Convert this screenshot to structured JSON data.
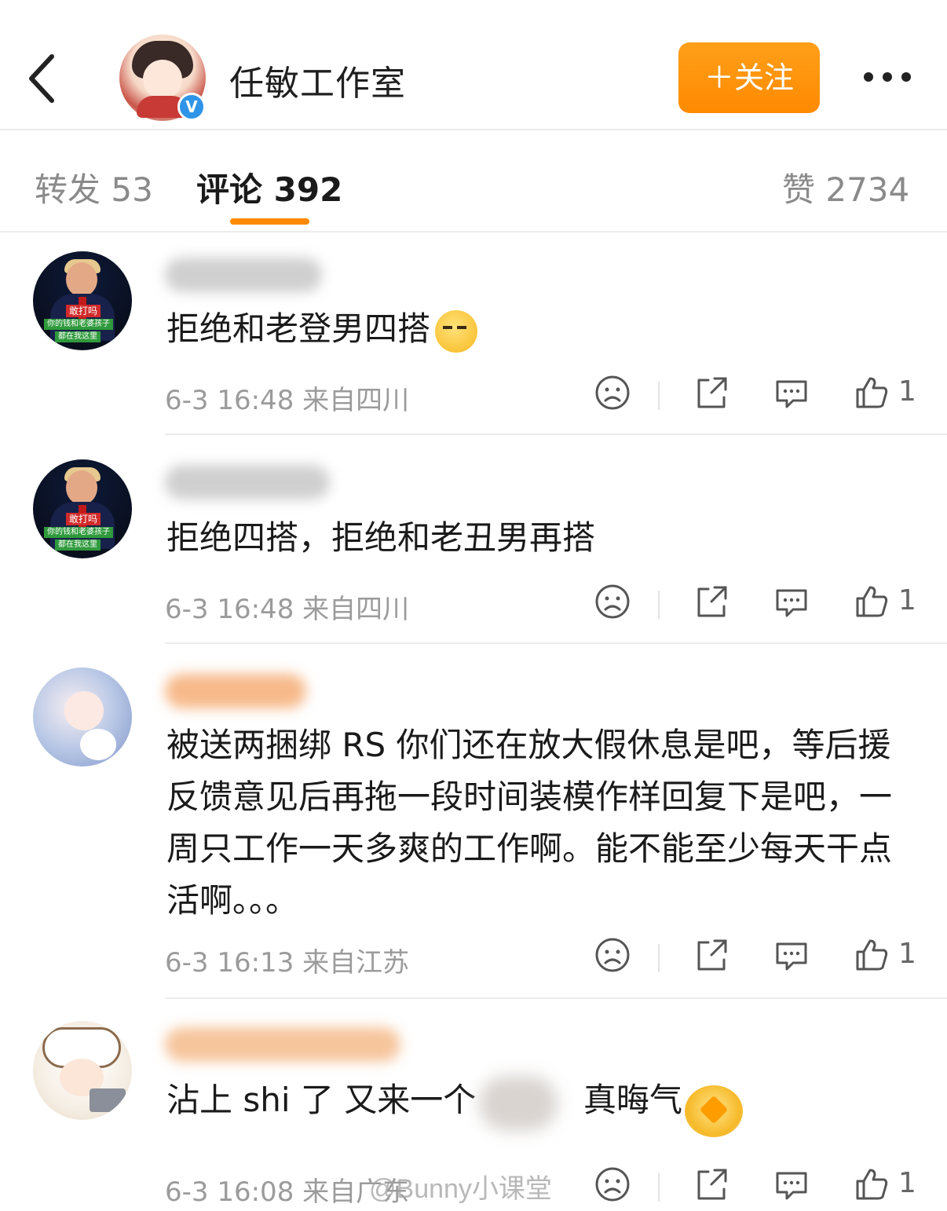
{
  "header": {
    "back_icon": "chevron-left-icon",
    "account_name": "任敏工作室",
    "verified_mark": "V",
    "follow_label": "＋关注",
    "more_icon": "more-dots-icon"
  },
  "tabs": {
    "repost": "转发 53",
    "comments": "评论 392",
    "likes": "赞 2734",
    "accent_color": "#ff8a00"
  },
  "comments": [
    {
      "text": "拒绝和老登男四搭",
      "emoji": "sweat-emoji",
      "meta": "6-3 16:48  来自四川",
      "like_count": "1"
    },
    {
      "text": "拒绝四搭，拒绝和老丑男再搭",
      "meta": "6-3 16:48  来自四川",
      "like_count": "1"
    },
    {
      "text": "被送两捆绑 RS 你们还在放大假休息是吧，等后援反馈意见后再拖一段时间装模作样回复下是吧，一周只工作一天多爽的工作啊。能不能至少每天干点活啊。。。",
      "meta": "6-3 16:13  来自江苏",
      "like_count": "1"
    },
    {
      "text_a": "沾上 shi 了 又来一个",
      "text_b": "真晦气",
      "meta": "6-3 16:08  来自广东",
      "like_count": "1"
    }
  ],
  "avatar_captions": {
    "line1": "敢打吗",
    "line2": "你的钱和老婆孩子",
    "line3": "都在我这里"
  },
  "watermark": "@Bunny小课堂",
  "action_icons": [
    "dislike-face-icon",
    "share-icon",
    "comment-bubble-icon",
    "thumbs-up-icon"
  ]
}
